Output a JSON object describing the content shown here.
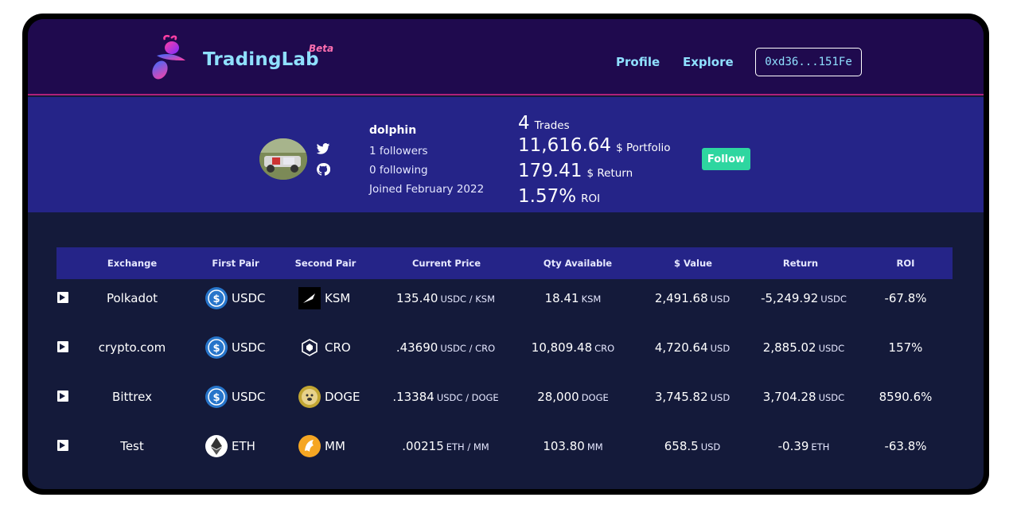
{
  "header": {
    "brand": "TradingLab",
    "beta": "Beta",
    "nav": [
      {
        "label": "Profile"
      },
      {
        "label": "Explore"
      }
    ],
    "wallet": "0xd36...151Fe"
  },
  "profile": {
    "username": "dolphin",
    "followers": "1 followers",
    "following": "0 following",
    "joined": "Joined February 2022",
    "stats": [
      {
        "value": "4",
        "label": "Trades"
      },
      {
        "value": "11,616.64",
        "label": "$ Portfolio"
      },
      {
        "value": "179.41",
        "label": "$ Return"
      },
      {
        "value": "1.57%",
        "label": "ROI"
      }
    ],
    "follow_label": "Follow"
  },
  "table": {
    "columns": [
      "Exchange",
      "First Pair",
      "Second Pair",
      "Current Price",
      "Qty Available",
      "$ Value",
      "Return",
      "ROI"
    ],
    "rows": [
      {
        "exchange": "Polkadot",
        "first": {
          "symbol": "USDC",
          "icon": "usdc-icon"
        },
        "second": {
          "symbol": "KSM",
          "icon": "ksm-icon"
        },
        "price": ".135.40",
        "price_unit": "USDC / KSM",
        "qty": "18.41",
        "qty_unit": "KSM",
        "value": "2,491.68",
        "value_unit": "USD",
        "ret": "-5,249.92",
        "ret_unit": "USDC",
        "roi": "-67.8%"
      },
      {
        "exchange": "crypto.com",
        "first": {
          "symbol": "USDC",
          "icon": "usdc-icon"
        },
        "second": {
          "symbol": "CRO",
          "icon": "cro-icon"
        },
        "price": ".43690",
        "price_unit": "USDC / CRO",
        "qty": "10,809.48",
        "qty_unit": "CRO",
        "value": "4,720.64",
        "value_unit": "USD",
        "ret": "2,885.02",
        "ret_unit": "USDC",
        "roi": "157%"
      },
      {
        "exchange": "Bittrex",
        "first": {
          "symbol": "USDC",
          "icon": "usdc-icon"
        },
        "second": {
          "symbol": "DOGE",
          "icon": "doge-icon"
        },
        "price": ".13384",
        "price_unit": "USDC / DOGE",
        "qty": "28,000",
        "qty_unit": "DOGE",
        "value": "3,745.82",
        "value_unit": "USD",
        "ret": "3,704.28",
        "ret_unit": "USDC",
        "roi": "8590.6%"
      },
      {
        "exchange": "Test",
        "first": {
          "symbol": "ETH",
          "icon": "eth-icon"
        },
        "second": {
          "symbol": "MM",
          "icon": "mm-icon"
        },
        "price": ".00215",
        "price_unit": "ETH / MM",
        "qty": "103.80",
        "qty_unit": "MM",
        "value": "658.5",
        "value_unit": "USD",
        "ret": "-0.39",
        "ret_unit": "ETH",
        "roi": "-63.8%"
      }
    ]
  },
  "colors": {
    "header_bg": "#1f0a4e",
    "band_bg": "#252488",
    "page_bg": "#141a3a",
    "accent": "#8fe0ff",
    "follow": "#2ed6a0"
  }
}
